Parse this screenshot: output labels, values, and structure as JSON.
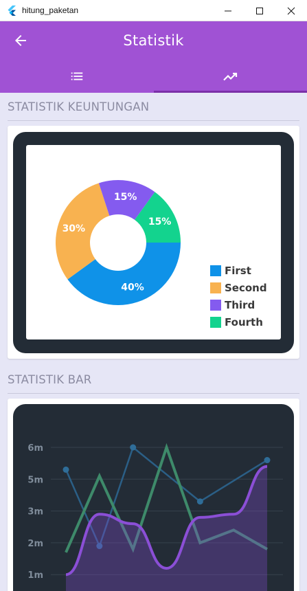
{
  "window": {
    "title": "hitung_paketan",
    "controls": [
      "minimize-icon",
      "maximize-icon",
      "close-icon"
    ]
  },
  "appbar": {
    "title": "Statistik",
    "back_icon": "arrow-left-icon",
    "color": "#a052d4"
  },
  "tabs": [
    {
      "icon": "list-icon",
      "active": false
    },
    {
      "icon": "trending-up-icon",
      "active": true
    }
  ],
  "sections": {
    "profit_title": "STATISTIK KEUNTUNGAN",
    "bar_title": "STATISTIK BAR"
  },
  "chart_data": [
    {
      "type": "pie",
      "title": "",
      "slices": [
        {
          "name": "First",
          "value": 40,
          "label": "40%",
          "color": "#0f92e8"
        },
        {
          "name": "Second",
          "value": 30,
          "label": "30%",
          "color": "#f8b250"
        },
        {
          "name": "Third",
          "value": 15,
          "label": "15%",
          "color": "#845bef"
        },
        {
          "name": "Fourth",
          "value": 15,
          "label": "15%",
          "color": "#13d38e"
        }
      ],
      "donut": true,
      "legend_position": "bottom-right"
    },
    {
      "type": "line",
      "title": "",
      "y_tick_labels": [
        "1m",
        "2m",
        "3m",
        "5m",
        "6m"
      ],
      "y_tick_values": [
        1,
        2,
        3,
        4,
        5
      ],
      "ylim": [
        1,
        6
      ],
      "x": [
        0,
        1,
        2,
        3,
        4,
        5,
        6
      ],
      "grid": true,
      "series": [
        {
          "values": [
            4.3,
            1.9,
            5.0,
            null,
            3.3,
            null,
            4.6
          ],
          "color": "#2b5f86",
          "style": "straight-with-dots"
        },
        {
          "values": [
            1.7,
            4.1,
            1.8,
            5.0,
            2.0,
            2.4,
            1.8
          ],
          "color": "#3e8a6a",
          "style": "straight"
        },
        {
          "values": [
            1.0,
            2.9,
            2.6,
            1.2,
            2.8,
            2.9,
            4.4
          ],
          "color": "#7e4bc7",
          "style": "curved-filled"
        }
      ]
    }
  ]
}
